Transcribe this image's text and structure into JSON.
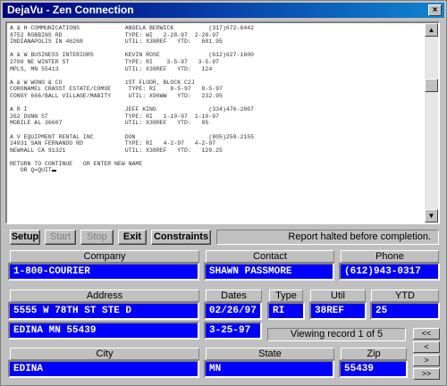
{
  "window": {
    "title": "DejaVu - Zen Connection",
    "close": "×"
  },
  "terminal": {
    "lines": [
      "A & H COMMUNICATIONS             ANGELA BERWICK          (317)672-6442",
      "8752 ROBBINS RD                  TYPE: WI   2-28-97  2-28-97",
      "INDIANAPOLIS IN 46268            UTIL: X38REF   YTD:   681.95",
      "",
      "A & W BUSINESS INTERIORS         KEVIN ROSE              (612)627-1600",
      "2700 NE WINTER ST                TYPE: RI    3-5-97   3-5-97",
      "MPLS, MN 55413                   UTIL: X38REF   YTD:   124",
      "",
      "A & W WONG & CO                  1ST FLOOR, BLOCK C2J",
      "CORONAMEL CRASST ESTATE/COMOE     TYPE: RI    8-5-97   8-5-97",
      "FONGY 666/BALL VILLAGE/MABITY     UTIL: X96WW   YTD:   232.95",
      "",
      "A R I                            JEFF KING               (334)476-2807",
      "262 DUNN ST                      TYPE: RI   1-10-97  1-10-97",
      "MOBILE AL 36607                  UTIL: X38REF   YTD:   85",
      "",
      "A V EQUIPMENT RENTAL INC         DON                     (805)258-2155",
      "24931 SAN FERNANDO RD            TYPE: RI   4-2-97   4-2-97",
      "NEWHALL CA 91321                 UTIL: X38REF   YTD:   129.25",
      "",
      "RETURN TO CONTINUE   OR ENTER NEW NAME",
      "   OR Q=QUIT"
    ],
    "scroll_up": "▲",
    "scroll_down": "▼"
  },
  "toolbar": {
    "setup": "Setup",
    "start": "Start",
    "stop": "Stop",
    "exit": "Exit",
    "constraints": "Constraints",
    "status": "Report halted before completion."
  },
  "labels": {
    "company": "Company",
    "contact": "Contact",
    "phone": "Phone",
    "address": "Address",
    "dates": "Dates",
    "type": "Type",
    "util": "Util",
    "ytd": "YTD",
    "city": "City",
    "state": "State",
    "zip": "Zip"
  },
  "record": {
    "company": "1-800-COURIER",
    "contact": "SHAWN PASSMORE",
    "phone": "(612)943-0317",
    "address1": "5555 W 78TH ST STE D",
    "address2": "EDINA MN 55439",
    "date1": "02/26/97",
    "date2": "3-25-97",
    "type": "RI",
    "util": "38REF",
    "ytd": "25",
    "city": "EDINA",
    "state": "MN",
    "zip": "55439"
  },
  "viewing": "Viewing record 1 of 5",
  "nav": {
    "first": "<<",
    "prev": "<",
    "next": ">",
    "last": ">>"
  },
  "colors": {
    "field_bg": "#0000ff",
    "title_bar": "#000080"
  }
}
